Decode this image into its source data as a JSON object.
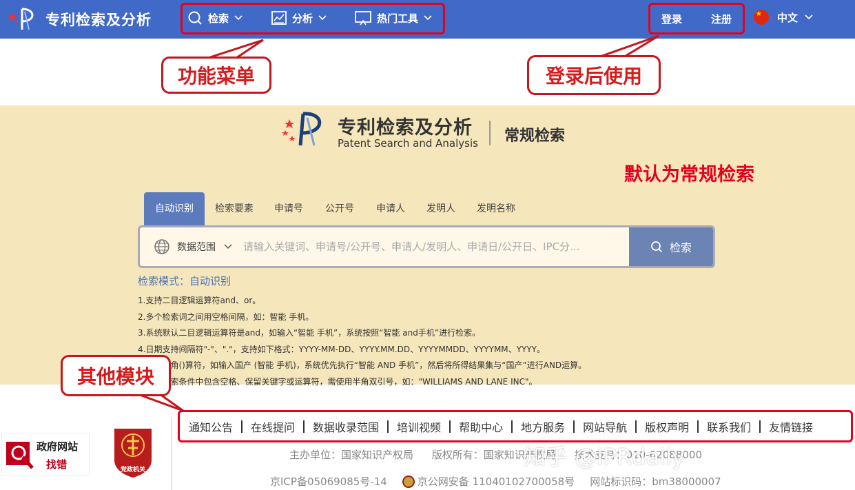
{
  "header": {
    "title": "专利检索及分析",
    "nav": [
      {
        "label": "检索",
        "icon": "search-icon"
      },
      {
        "label": "分析",
        "icon": "chart-icon"
      },
      {
        "label": "热门工具",
        "icon": "monitor-icon"
      }
    ],
    "login": "登录",
    "register": "注册",
    "language": "中文"
  },
  "callouts": {
    "menu": "功能菜单",
    "login": "登录后使用",
    "default": "默认为常规检索",
    "other": "其他模块"
  },
  "brand": {
    "cn": "专利检索及分析",
    "en": "Patent Search and Analysis",
    "mode": "常规检索"
  },
  "tabs": [
    "自动识别",
    "检索要素",
    "申请号",
    "公开号",
    "申请人",
    "发明人",
    "发明名称"
  ],
  "search": {
    "scope": "数据范围",
    "placeholder": "请输入关键词、申请号/公开号、申请人/发明人、申请日/公开日、IPC分...",
    "button": "检索"
  },
  "mode_text": "检索模式：自动识别",
  "rules": [
    "1.支持二目逻辑运算符and、or。",
    "2.多个检索词之间用空格间隔，如：智能 手机。",
    "3.系统默认二目逻辑运算符是and，如输入“智能 手机”，系统按照“智能 and手机”进行检索。",
    "4.日期支持间隔符\"-\"、\".\"，支持如下格式：YYYY-MM-DD、YYYY.MM.DD、YYYYMMDD、YYYYMM、YYYY。",
    "5.支持半角()算符，如输入国产 (智能 手机)，系统优先执行“智能 AND 手机”，然后将所得结果集与“国产”进行AND运算。",
    "6.如果检索条件中包含空格、保留关键字或运算符，需使用半角双引号，如：\"WILLIAMS AND LANE INC\"。"
  ],
  "footer": {
    "gov_line1": "政府网站",
    "gov_line2": "找错",
    "party": "党政机关",
    "links": [
      "通知公告",
      "在线提问",
      "数据收录范围",
      "培训视频",
      "帮助中心",
      "地方服务",
      "网站导航",
      "版权声明",
      "联系我们",
      "友情链接"
    ],
    "sponsor": "主办单位：国家知识产权局",
    "copyright": "版权所有：国家知识产权局",
    "tech": "技术支持：010-62088000",
    "icp": "京ICP备05069085号-14",
    "police": "京公网安备 11040102700058号",
    "site_id": "网站标识码：bm38000007",
    "watermark": "知乎 @IPRdaily"
  }
}
